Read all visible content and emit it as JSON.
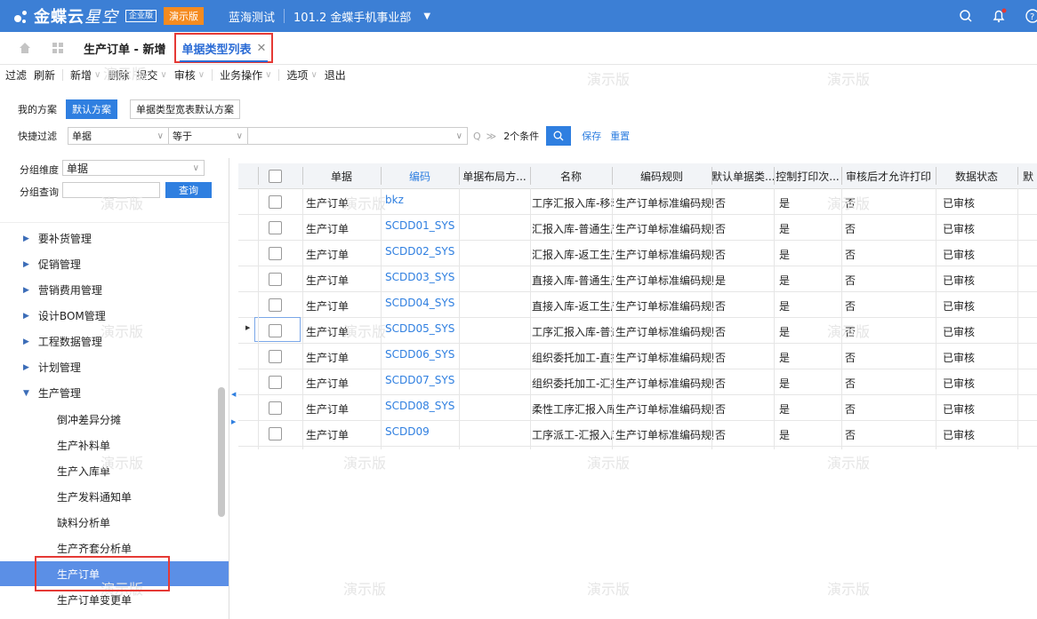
{
  "topbar": {
    "brand": "金蝶云",
    "brand_sub": "星空",
    "edition": "企业版",
    "demo_badge": "演示版",
    "company": "蓝海测试",
    "org": "101.2 金蝶手机事业部"
  },
  "tabs": {
    "home_icon": "home-icon",
    "apps_icon": "grid-icon",
    "tab1": "生产订单 - 新增",
    "tab2": "单据类型列表",
    "close": "✕"
  },
  "toolbar": {
    "filter": "过滤",
    "refresh": "刷新",
    "add": "新增",
    "delete": "删除",
    "submit": "提交",
    "audit": "审核",
    "biz_ops": "业务操作",
    "options": "选项",
    "exit": "退出"
  },
  "scheme": {
    "label": "我的方案",
    "default": "默认方案",
    "other": "单据类型宽表默认方案"
  },
  "quickfilter": {
    "label": "快捷过滤",
    "field": "单据",
    "op": "等于",
    "value": "",
    "conditions": "2个条件",
    "save": "保存",
    "reset": "重置"
  },
  "left": {
    "group_dim_label": "分组维度",
    "group_dim_value": "单据",
    "group_query_label": "分组查询",
    "group_query_value": "",
    "query_button": "查询",
    "tree": [
      {
        "label": "要补货管理",
        "expanded": false
      },
      {
        "label": "促销管理",
        "expanded": false
      },
      {
        "label": "营销费用管理",
        "expanded": false
      },
      {
        "label": "设计BOM管理",
        "expanded": false
      },
      {
        "label": "工程数据管理",
        "expanded": false
      },
      {
        "label": "计划管理",
        "expanded": false
      },
      {
        "label": "生产管理",
        "expanded": true
      }
    ],
    "children": [
      "倒冲差异分摊",
      "生产补料单",
      "生产入库单",
      "生产发料通知单",
      "缺料分析单",
      "生产齐套分析单",
      "生产订单",
      "生产订单变更单"
    ],
    "selected": "生产订单"
  },
  "grid": {
    "headers": [
      "单据",
      "编码",
      "单据布局方...",
      "名称",
      "编码规则",
      "默认单据类...",
      "控制打印次...",
      "审核后才允许打印",
      "数据状态",
      "默"
    ],
    "rows": [
      [
        "生产订单",
        "bkz",
        "",
        "工序汇报入库-移动",
        "生产订单标准编码规则",
        "否",
        "是",
        "否",
        "已审核"
      ],
      [
        "生产订单",
        "SCDD01_SYS",
        "",
        "汇报入库-普通生产",
        "生产订单标准编码规则",
        "否",
        "是",
        "否",
        "已审核"
      ],
      [
        "生产订单",
        "SCDD02_SYS",
        "",
        "汇报入库-返工生产",
        "生产订单标准编码规则",
        "否",
        "是",
        "否",
        "已审核"
      ],
      [
        "生产订单",
        "SCDD03_SYS",
        "",
        "直接入库-普通生产",
        "生产订单标准编码规则",
        "是",
        "是",
        "否",
        "已审核"
      ],
      [
        "生产订单",
        "SCDD04_SYS",
        "",
        "直接入库-返工生产",
        "生产订单标准编码规则",
        "否",
        "是",
        "否",
        "已审核"
      ],
      [
        "生产订单",
        "SCDD05_SYS",
        "",
        "工序汇报入库-普通",
        "生产订单标准编码规则",
        "否",
        "是",
        "否",
        "已审核"
      ],
      [
        "生产订单",
        "SCDD06_SYS",
        "",
        "组织委托加工-直接",
        "生产订单标准编码规则",
        "否",
        "是",
        "否",
        "已审核"
      ],
      [
        "生产订单",
        "SCDD07_SYS",
        "",
        "组织委托加工-汇报",
        "生产订单标准编码规则",
        "否",
        "是",
        "否",
        "已审核"
      ],
      [
        "生产订单",
        "SCDD08_SYS",
        "",
        "柔性工序汇报入库-",
        "生产订单标准编码规则",
        "否",
        "是",
        "否",
        "已审核"
      ],
      [
        "生产订单",
        "SCDD09",
        "",
        "工序派工-汇报入库",
        "生产订单标准编码规则",
        "否",
        "是",
        "否",
        "已审核"
      ]
    ]
  },
  "watermark": "演示版",
  "colors": {
    "accent": "#3c7fd5",
    "highlight": "#e53935",
    "selected_row": "#5b8fe6",
    "link": "#2f7fe0"
  }
}
